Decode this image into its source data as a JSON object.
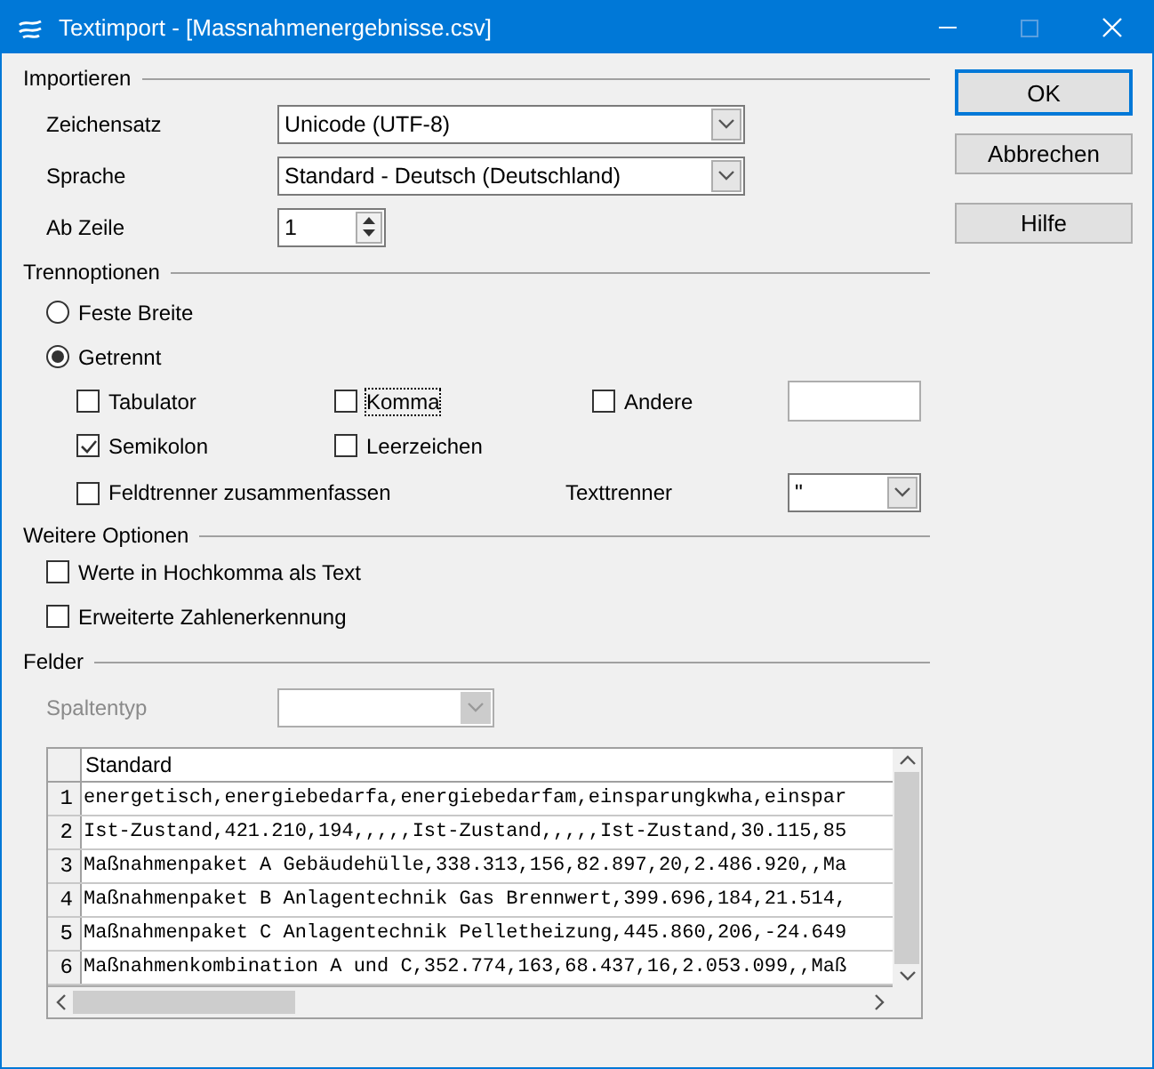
{
  "window": {
    "title": "Textimport - [Massnahmenergebnisse.csv]"
  },
  "import": {
    "heading": "Importieren",
    "fields": [
      {
        "label": "Zeichensatz",
        "kind": "dropdown",
        "value": "Unicode (UTF-8)"
      },
      {
        "label": "Sprache",
        "kind": "dropdown",
        "value": "Standard - Deutsch (Deutschland)"
      },
      {
        "label": "Ab Zeile",
        "kind": "spin",
        "value": "1"
      }
    ]
  },
  "separator_options": {
    "heading": "Trennoptionen",
    "modes": [
      {
        "label": "Feste Breite",
        "selected": false
      },
      {
        "label": "Getrennt",
        "selected": true
      }
    ],
    "checkboxes": [
      {
        "label": "Tabulator",
        "checked": false,
        "focused": false
      },
      {
        "label": "Komma",
        "checked": false,
        "focused": true
      },
      {
        "label": "Andere",
        "checked": false,
        "focused": false
      },
      {
        "label": "Semikolon",
        "checked": true,
        "focused": false
      },
      {
        "label": "Leerzeichen",
        "checked": false,
        "focused": false
      }
    ],
    "merge": {
      "label": "Feldtrenner zusammenfassen",
      "checked": false
    },
    "text_delimiter": {
      "label": "Texttrenner",
      "value": "\""
    }
  },
  "more_options": {
    "heading": "Weitere Optionen",
    "checkboxes": [
      {
        "label": "Werte in Hochkomma als Text",
        "checked": false
      },
      {
        "label": "Erweiterte Zahlenerkennung",
        "checked": false
      }
    ]
  },
  "fields": {
    "heading": "Felder",
    "column_type": {
      "label": "Spaltentyp",
      "disabled": true
    },
    "preview": {
      "column_header": "Standard",
      "rows": [
        {
          "number": "1",
          "text": "energetisch,energiebedarfa,energiebedarfam,einsparungkwha,einspar"
        },
        {
          "number": "2",
          "text": "Ist-Zustand,421.210,194,,,,,Ist-Zustand,,,,,Ist-Zustand,30.115,85"
        },
        {
          "number": "3",
          "text": "Maßnahmenpaket A Gebäudehülle,338.313,156,82.897,20,2.486.920,,Ma"
        },
        {
          "number": "4",
          "text": "Maßnahmenpaket B Anlagentechnik Gas Brennwert,399.696,184,21.514,"
        },
        {
          "number": "5",
          "text": "Maßnahmenpaket C Anlagentechnik Pelletheizung,445.860,206,-24.649"
        },
        {
          "number": "6",
          "text": "Maßnahmenkombination A und C,352.774,163,68.437,16,2.053.099,,Maß"
        }
      ]
    }
  },
  "buttons": [
    {
      "label": "OK",
      "default": true
    },
    {
      "label": "Abbrechen",
      "default": false
    },
    {
      "label": "Hilfe",
      "default": false
    }
  ]
}
